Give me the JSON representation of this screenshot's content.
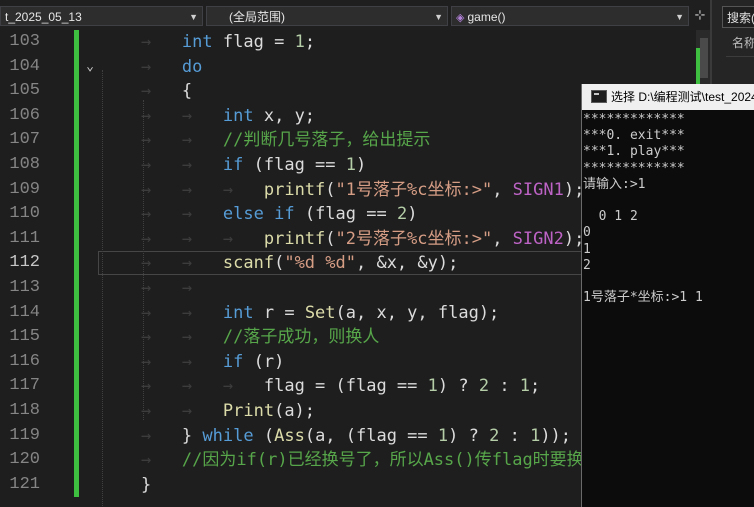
{
  "navbar": {
    "project": "t_2025_05_13",
    "scope": "(全局范围)",
    "function": "game()",
    "split_icon": "add-split-icon"
  },
  "side_panel": {
    "search_text": "搜索(",
    "column_header": "名称"
  },
  "editor": {
    "current_line": 112,
    "lines": [
      {
        "n": "103"
      },
      {
        "n": "104"
      },
      {
        "n": "105"
      },
      {
        "n": "106"
      },
      {
        "n": "107"
      },
      {
        "n": "108"
      },
      {
        "n": "109"
      },
      {
        "n": "110"
      },
      {
        "n": "111"
      },
      {
        "n": "112"
      },
      {
        "n": "113"
      },
      {
        "n": "114"
      },
      {
        "n": "115"
      },
      {
        "n": "116"
      },
      {
        "n": "117"
      },
      {
        "n": "118"
      },
      {
        "n": "119"
      },
      {
        "n": "120"
      },
      {
        "n": "121"
      }
    ],
    "code": {
      "l103": {
        "type": "int",
        "id": "flag",
        "op": "=",
        "num": "1",
        "end": ";"
      },
      "l104": {
        "kw": "do"
      },
      "l105": {
        "brace": "{"
      },
      "l106": {
        "type": "int",
        "rest": "x, y;"
      },
      "l107": {
        "comment": "//判断几号落子，给出提示"
      },
      "l108": {
        "kw": "if",
        "a": "(flag == ",
        "num": "1",
        "b": ")"
      },
      "l109": {
        "fn": "printf",
        "a": "(",
        "str": "\"1号落子%c坐标:>\"",
        "b": ", ",
        "macro": "SIGN1",
        "c": ");"
      },
      "l110": {
        "kw1": "else",
        "kw2": "if",
        "a": "(flag == ",
        "num": "2",
        "b": ")"
      },
      "l111": {
        "fn": "printf",
        "a": "(",
        "str": "\"2号落子%c坐标:>\"",
        "b": ", ",
        "macro": "SIGN2",
        "c": ");"
      },
      "l112": {
        "fn": "scanf",
        "a": "(",
        "str": "\"%d %d\"",
        "b": ", &x, &y);"
      },
      "l114": {
        "type": "int",
        "a": "r = ",
        "fn": "Set",
        "b": "(a, x, y, flag);"
      },
      "l115": {
        "comment": "//落子成功，则换人"
      },
      "l116": {
        "kw": "if",
        "a": "(r)"
      },
      "l117": {
        "a": "flag = (flag == ",
        "num1": "1",
        "b": ") ? ",
        "num2": "2",
        "c": " : ",
        "num3": "1",
        "d": ";"
      },
      "l118": {
        "fn": "Print",
        "a": "(a);"
      },
      "l119": {
        "brace": "}",
        "kw": "while",
        "a": "(",
        "fn": "Ass",
        "b": "(a, (flag == ",
        "num1": "1",
        "c": ") ? ",
        "num2": "2",
        "d": " : ",
        "num3": "1",
        "e": "));"
      },
      "l120": {
        "comment": "//因为if(r)已经换号了，所以Ass()传flag时要换"
      },
      "l121": {
        "brace": "}"
      }
    }
  },
  "console": {
    "title": "选择 D:\\编程测试\\test_2024",
    "output": "*************\n***0. exit***\n***1. play***\n*************\n请输入:>1\n\n  0 1 2\n0\n1\n2\n\n1号落子*坐标:>1 1"
  },
  "colors": {
    "keyword": "#569cd6",
    "comment": "#57a64a",
    "string": "#d69d85",
    "number": "#b5cea8",
    "function": "#dcdcaa",
    "variable": "#9cdcfe",
    "macro": "#bd63c5",
    "change_marker": "#3fbf3f"
  }
}
